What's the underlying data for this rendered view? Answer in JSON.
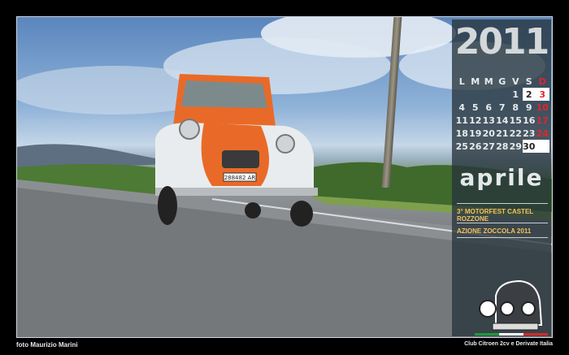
{
  "calendar": {
    "year": "2011",
    "weekdays": [
      "L",
      "M",
      "M",
      "G",
      "V",
      "S",
      "D"
    ],
    "weeks": [
      [
        "",
        "",
        "",
        "",
        "1",
        "2",
        "3"
      ],
      [
        "4",
        "5",
        "6",
        "7",
        "8",
        "9",
        "10"
      ],
      [
        "11",
        "12",
        "13",
        "14",
        "15",
        "16",
        "17"
      ],
      [
        "18",
        "19",
        "20",
        "21",
        "22",
        "23",
        "24"
      ],
      [
        "25",
        "26",
        "27",
        "28",
        "29",
        "30",
        ""
      ]
    ],
    "month": "aprile",
    "events": [
      "3° MOTORFEST CASTEL ROZZONE",
      "AZIONE ZOCCOLA 2011"
    ]
  },
  "photo": {
    "plate": "288482 AR"
  },
  "footer": {
    "credit": "foto Maurizio Marini",
    "club": "Club Citroen 2cv e Derivate Italia"
  },
  "colors": {
    "sunday_red": "#e0262c",
    "car_orange": "#e96a28",
    "panel": "#28343c"
  }
}
